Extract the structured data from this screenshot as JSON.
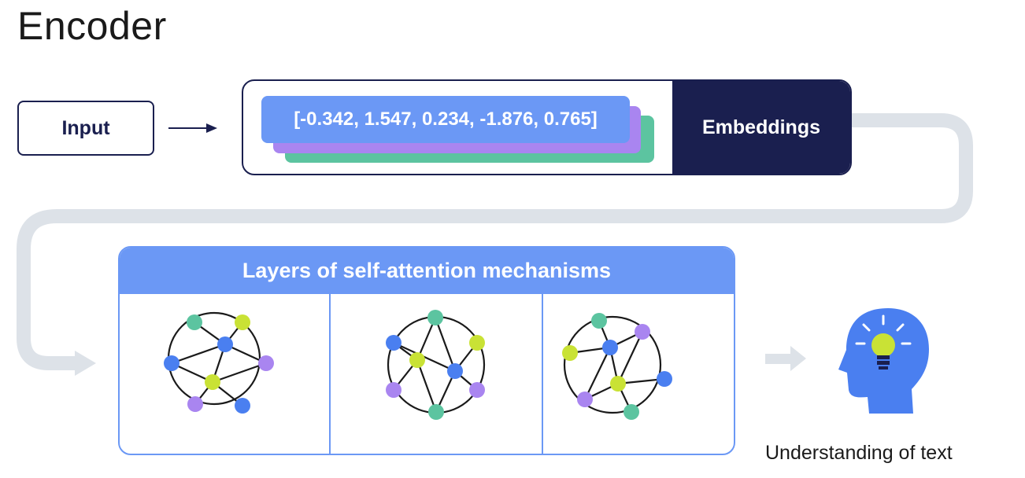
{
  "title": "Encoder",
  "input_label": "Input",
  "embedding_vector": "[-0.342, 1.547, 0.234, -1.876, 0.765]",
  "embeddings_label": "Embeddings",
  "layers_title": "Layers of self-attention mechanisms",
  "output_label": "Understanding of text",
  "colors": {
    "navy": "#1a1f4f",
    "blue": "#6b98f5",
    "purple": "#a985f0",
    "green": "#5cc4a0",
    "lime": "#c9e235",
    "node_blue": "#4a7ff0",
    "connector_gray": "#dde2e8",
    "head_blue": "#4a7ff0"
  },
  "icons": [
    "arrow-right-icon",
    "network-graph-icon",
    "head-lightbulb-icon"
  ]
}
